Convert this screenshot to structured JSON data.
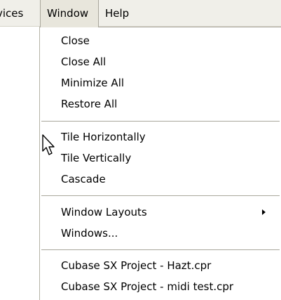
{
  "menubar": {
    "devices_label": "vices",
    "window_label": "Window",
    "help_label": "Help"
  },
  "window_menu": {
    "items": [
      {
        "label": "Close"
      },
      {
        "label": "Close All"
      },
      {
        "label": "Minimize All"
      },
      {
        "label": "Restore All"
      },
      {
        "label": "Tile Horizontally"
      },
      {
        "label": "Tile Vertically"
      },
      {
        "label": "Cascade"
      },
      {
        "label": "Window Layouts",
        "submenu": true
      },
      {
        "label": "Windows..."
      },
      {
        "label": "Cubase SX Project - Hazt.cpr"
      },
      {
        "label": "Cubase SX Project - midi test.cpr"
      }
    ]
  },
  "icons": {
    "submenu_arrow": "chevron-right-icon",
    "cursor": "mouse-pointer-icon"
  },
  "colors": {
    "menubar_bg": "#f0efe9",
    "menu_bg": "#ffffff",
    "separator": "#a9a79c"
  }
}
